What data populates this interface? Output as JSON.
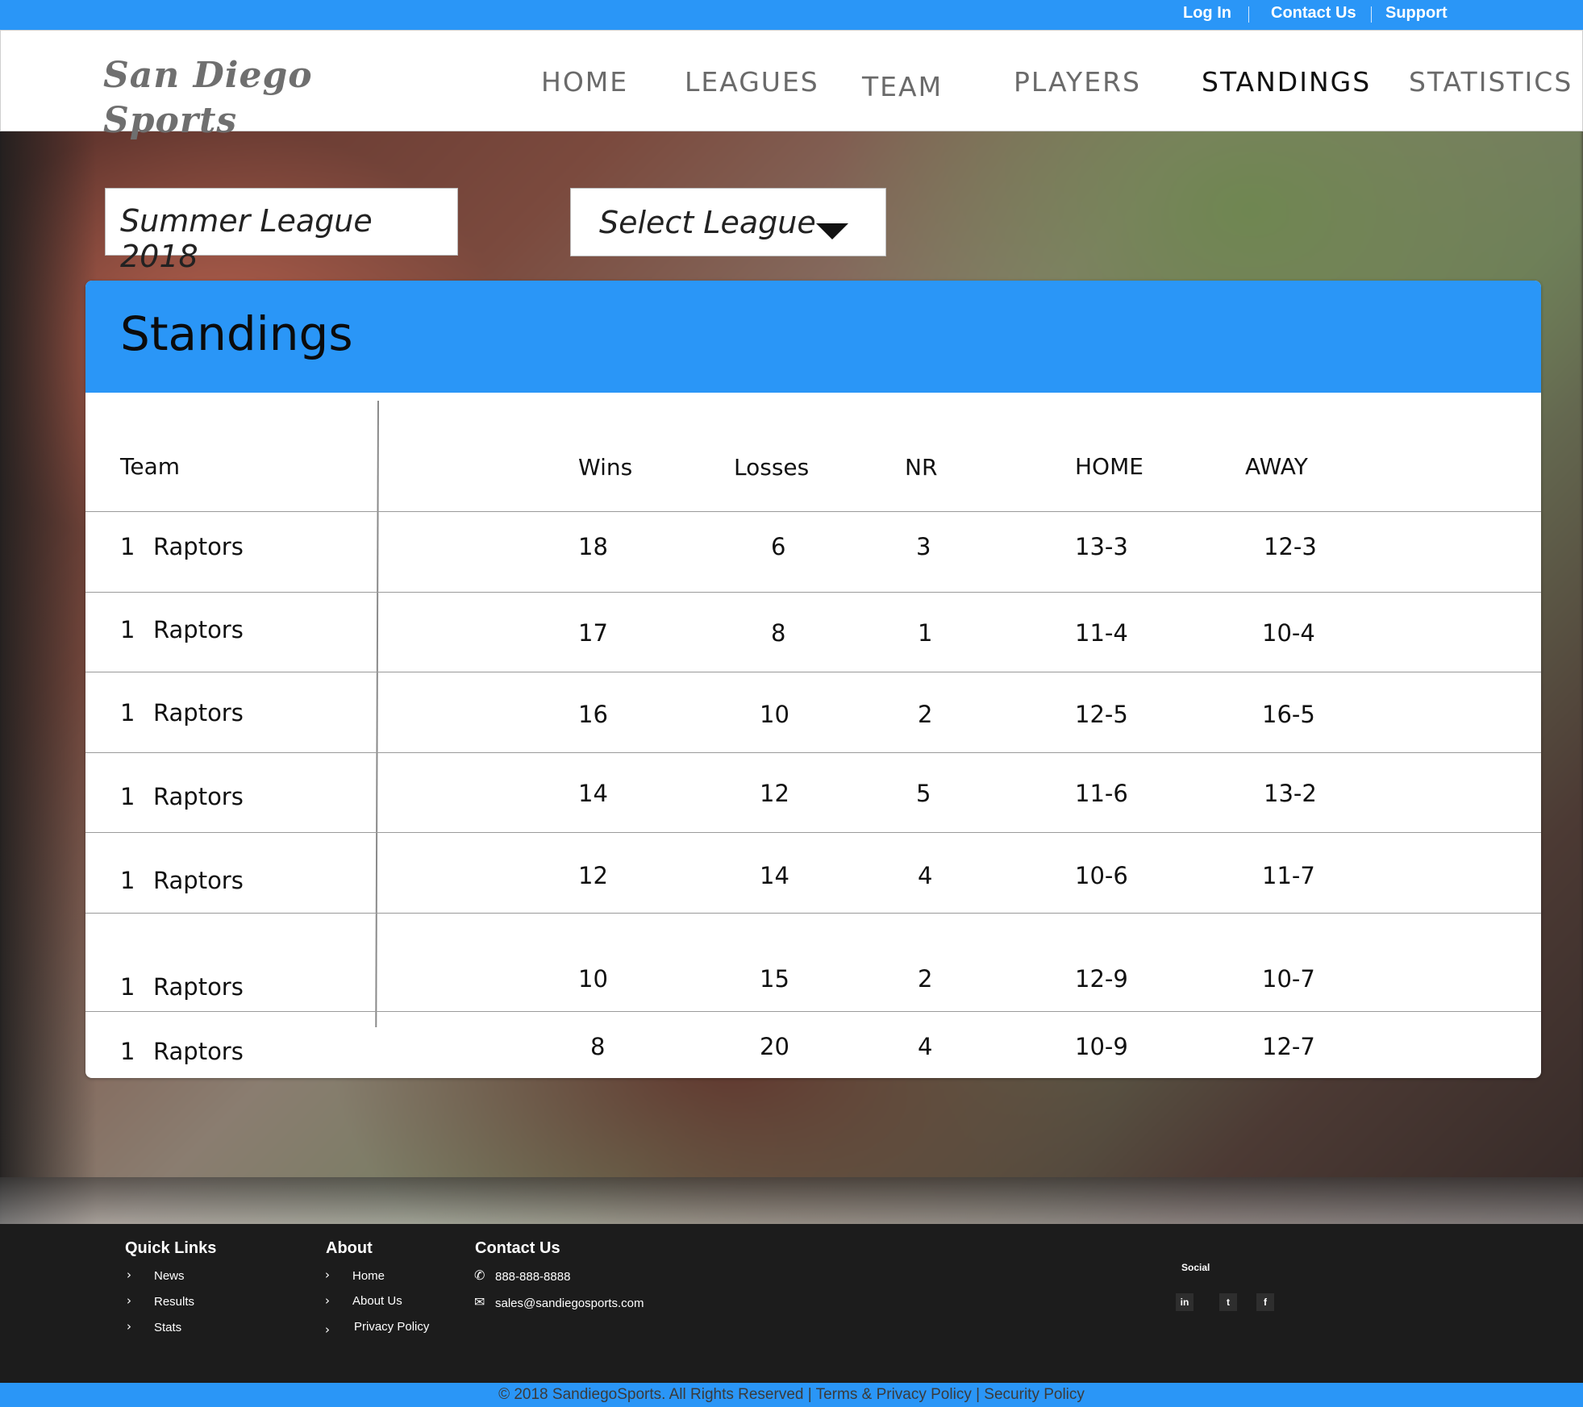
{
  "top_links": {
    "login": "Log In",
    "contact": "Contact Us",
    "support": "Support"
  },
  "brand": {
    "line1": "San Diego",
    "line2": "Sports"
  },
  "nav": [
    "HOME",
    "LEAGUES",
    "TEAM",
    "PLAYERS",
    "STANDINGS",
    "STATISTICS"
  ],
  "nav_active": "STANDINGS",
  "season": "Summer League 2018",
  "league_select": {
    "selected": "Select League"
  },
  "standings": {
    "title": "Standings",
    "columns": [
      "Team",
      "Wins",
      "Losses",
      "NR",
      "HOME",
      "AWAY"
    ],
    "rows": [
      {
        "rank": "1",
        "team": "Raptors",
        "wins": "18",
        "losses": "6",
        "nr": "3",
        "home": "13-3",
        "away": "12-3"
      },
      {
        "rank": "1",
        "team": "Raptors",
        "wins": "17",
        "losses": "8",
        "nr": "1",
        "home": "11-4",
        "away": "10-4"
      },
      {
        "rank": "1",
        "team": "Raptors",
        "wins": "16",
        "losses": "10",
        "nr": "2",
        "home": "12-5",
        "away": "16-5"
      },
      {
        "rank": "1",
        "team": "Raptors",
        "wins": "14",
        "losses": "12",
        "nr": "5",
        "home": "11-6",
        "away": "13-2"
      },
      {
        "rank": "1",
        "team": "Raptors",
        "wins": "12",
        "losses": "14",
        "nr": "4",
        "home": "10-6",
        "away": "11-7"
      },
      {
        "rank": "1",
        "team": "Raptors",
        "wins": "10",
        "losses": "15",
        "nr": "2",
        "home": "12-9",
        "away": "10-7"
      },
      {
        "rank": "1",
        "team": "Raptors",
        "wins": "8",
        "losses": "20",
        "nr": "4",
        "home": "10-9",
        "away": "12-7"
      }
    ]
  },
  "footer": {
    "quick_links": {
      "heading": "Quick Links",
      "items": [
        "News",
        "Results",
        "Stats"
      ]
    },
    "about": {
      "heading": "About",
      "items": [
        "Home",
        "About Us",
        "Privacy Policy"
      ]
    },
    "contact": {
      "heading": "Contact Us",
      "phone": "888-888-8888",
      "email": "sales@sandiegosports.com"
    },
    "social": {
      "heading": "Social",
      "linkedin": "in",
      "twitter": "t",
      "facebook": "f"
    }
  },
  "copyright": "© 2018 SandiegoSports. All Rights Reserved | Terms & Privacy Policy | Security Policy",
  "colors": {
    "accent": "#2a96f7",
    "footer_bg": "#1c1c1c"
  }
}
